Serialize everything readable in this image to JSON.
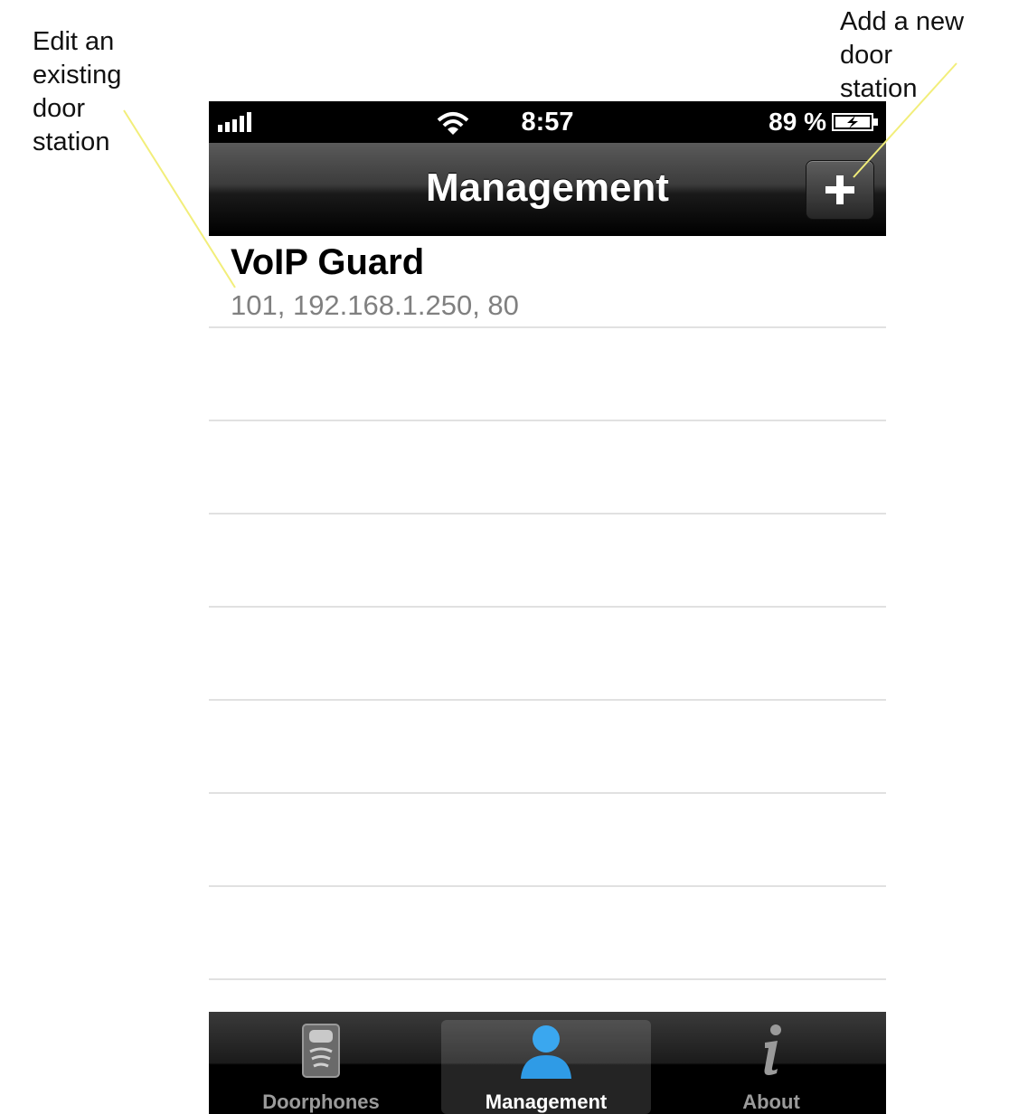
{
  "annotations": {
    "edit": [
      "Edit an",
      "existing",
      "door",
      "station"
    ],
    "add": [
      "Add a new",
      "door",
      "station"
    ]
  },
  "statusbar": {
    "time": "8:57",
    "battery": "89 %",
    "icons": [
      "signal-icon",
      "wifi-icon",
      "battery-charging-icon"
    ]
  },
  "navbar": {
    "title": "Management",
    "add_icon": "plus-icon"
  },
  "list": {
    "items": [
      {
        "title": "VoIP Guard",
        "subtitle": "101, 192.168.1.250, 80"
      }
    ]
  },
  "tabbar": {
    "tabs": [
      {
        "label": "Doorphones",
        "icon": "doorphone-icon"
      },
      {
        "label": "Management",
        "icon": "person-icon",
        "active": true
      },
      {
        "label": "About",
        "icon": "info-icon"
      }
    ]
  },
  "colors": {
    "annotation_line": "#f2ee7a",
    "tab_active_icon": "#2f9be6"
  }
}
